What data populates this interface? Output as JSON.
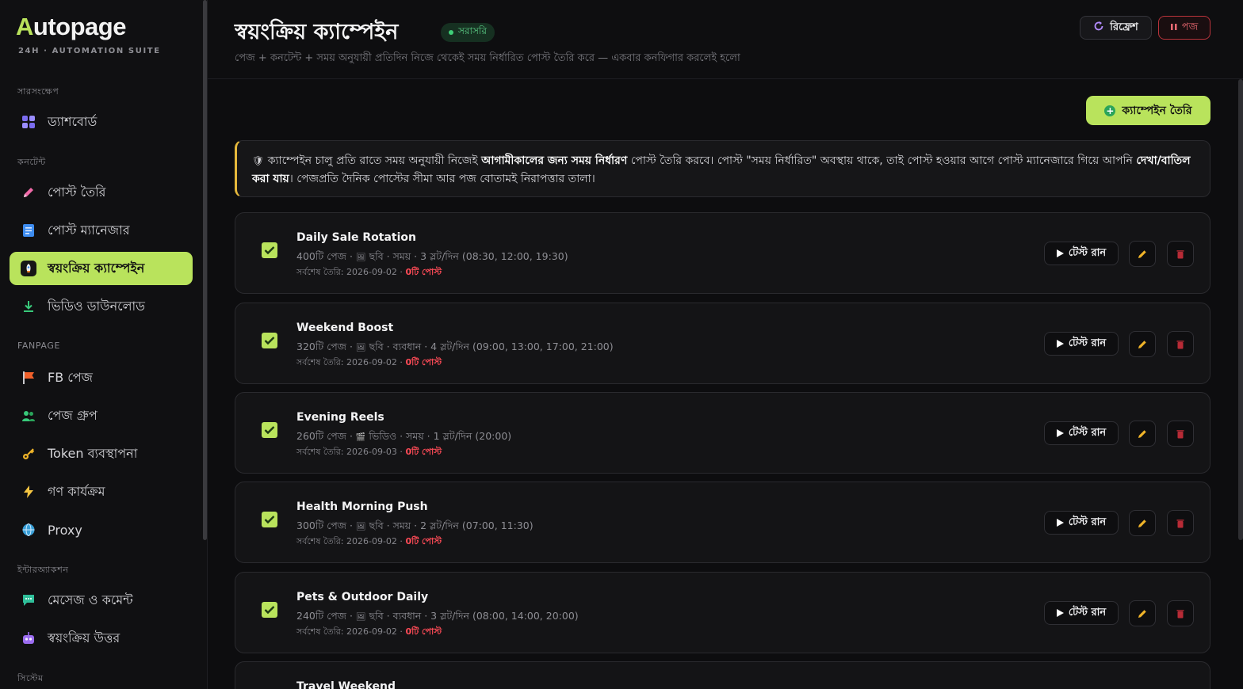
{
  "brand": {
    "name_first": "A",
    "name_rest": "utopage",
    "tagline": "24H · AUTOMATION SUITE"
  },
  "sidebar": {
    "sections": [
      {
        "label": "সারসংক্ষেপ"
      },
      {
        "label": "কনটেন্ট"
      },
      {
        "label": "FANPAGE"
      },
      {
        "label": "ইন্টারঅ্যাকশন"
      },
      {
        "label": "সিস্টেম"
      }
    ],
    "items": [
      {
        "label": "ড্যাশবোর্ড",
        "icon": "grid-icon"
      },
      {
        "label": "পোস্ট তৈরি",
        "icon": "pencil-icon"
      },
      {
        "label": "পোস্ট ম্যানেজার",
        "icon": "document-icon"
      },
      {
        "label": "স্বয়ংক্রিয় ক্যাম্পেইন",
        "icon": "rocket-icon",
        "active": true
      },
      {
        "label": "ভিডিও ডাউনলোড",
        "icon": "download-icon"
      },
      {
        "label": "FB পেজ",
        "icon": "flag-icon"
      },
      {
        "label": "পেজ গ্রুপ",
        "icon": "users-icon"
      },
      {
        "label": "Token ব্যবস্থাপনা",
        "icon": "key-icon"
      },
      {
        "label": "গণ কার্যক্রম",
        "icon": "lightning-icon"
      },
      {
        "label": "Proxy",
        "icon": "globe-icon"
      },
      {
        "label": "মেসেজ ও কমেন্ট",
        "icon": "chat-icon"
      },
      {
        "label": "স্বয়ংক্রিয় উত্তর",
        "icon": "robot-icon"
      }
    ]
  },
  "header": {
    "title": "স্বয়ংক্রিয় ক্যাম্পেইন",
    "badge": "সরাসরি",
    "subtitle": "পেজ + কনটেন্ট + সময় অনুযায়ী প্রতিদিন নিজে থেকেই সময় নির্ধারিত পোস্ট তৈরি করে — একবার কনফিগার করলেই হলো",
    "refresh_label": "রিফ্রেশ",
    "pause_label": "পজ"
  },
  "toolbar": {
    "create_label": "ক্যাম্পেইন তৈরি"
  },
  "notice": {
    "p1": "ক্যাম্পেইন চালু প্রতি রাতে সময় অনুযায়ী নিজেই ",
    "b1": "আগামীকালের জন্য সময় নির্ধারণ",
    "p2": " পোস্ট তৈরি করবে। পোস্ট \"সময় নির্ধারিত\" অবস্থায় থাকে, তাই পোস্ট হওয়ার আগে পোস্ট ম্যানেজারে গিয়ে আপনি ",
    "b2": "দেখা/বাতিল করা যায়",
    "p3": "। পেজপ্রতি দৈনিক পোস্টের সীমা আর পজ বোতামই নিরাপত্তার তালা।"
  },
  "campaign_labels": {
    "last_created_prefix": "সর্বশেষ তৈরি:",
    "test_run": "টেস্ট রান"
  },
  "campaigns": [
    {
      "name": "Daily Sale Rotation",
      "pages": "400টি পেজ",
      "media": "ছবি",
      "media_icon": "image-icon",
      "mode": "সময়",
      "slots": "3 স্লট/দিন (08:30, 12:00, 19:30)",
      "last_date": "2026-09-02",
      "posts": "0টি পোস্ট",
      "enabled": true
    },
    {
      "name": "Weekend Boost",
      "pages": "320টি পেজ",
      "media": "ছবি",
      "media_icon": "image-icon",
      "mode": "ব্যবধান",
      "slots": "4 স্লট/দিন (09:00, 13:00, 17:00, 21:00)",
      "last_date": "2026-09-02",
      "posts": "0টি পোস্ট",
      "enabled": true
    },
    {
      "name": "Evening Reels",
      "pages": "260টি পেজ",
      "media": "ভিডিও",
      "media_icon": "clapper-icon",
      "mode": "সময়",
      "slots": "1 স্লট/দিন (20:00)",
      "last_date": "2026-09-03",
      "posts": "0টি পোস্ট",
      "enabled": true
    },
    {
      "name": "Health Morning Push",
      "pages": "300টি পেজ",
      "media": "ছবি",
      "media_icon": "image-icon",
      "mode": "সময়",
      "slots": "2 স্লট/দিন (07:00, 11:30)",
      "last_date": "2026-09-02",
      "posts": "0টি পোস্ট",
      "enabled": true
    },
    {
      "name": "Pets & Outdoor Daily",
      "pages": "240টি পেজ",
      "media": "ছবি",
      "media_icon": "image-icon",
      "mode": "ব্যবধান",
      "slots": "3 স্লট/দিন (08:00, 14:00, 20:00)",
      "last_date": "2026-09-02",
      "posts": "0টি পোস্ট",
      "enabled": true
    },
    {
      "name": "Travel Weekend"
    }
  ],
  "colors": {
    "accent": "#b9e35c",
    "danger": "#ff4b57",
    "live": "#3fcf78",
    "notice_border": "#e6b93c"
  }
}
